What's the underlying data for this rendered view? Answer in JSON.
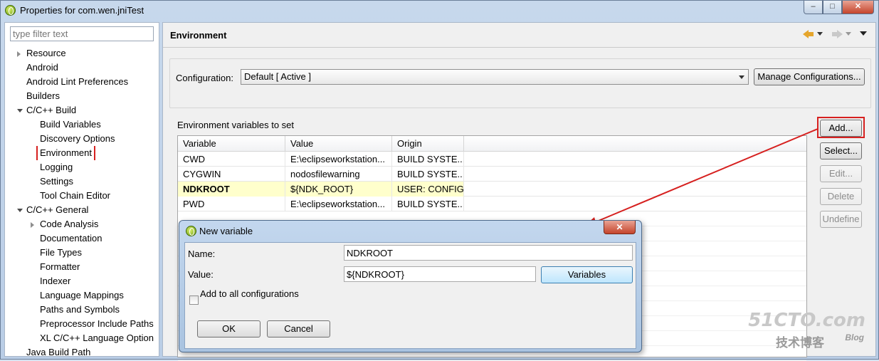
{
  "window": {
    "title": "Properties for com.wen.jniTest",
    "caption": {
      "minimize": "–",
      "maximize": "□",
      "close": "✕"
    }
  },
  "left_panel": {
    "filter_placeholder": "type filter text",
    "tree": [
      {
        "label": "Resource",
        "level": 0,
        "twisty": "closed"
      },
      {
        "label": "Android",
        "level": 0,
        "twisty": "none"
      },
      {
        "label": "Android Lint Preferences",
        "level": 0,
        "twisty": "none"
      },
      {
        "label": "Builders",
        "level": 0,
        "twisty": "none"
      },
      {
        "label": "C/C++ Build",
        "level": 0,
        "twisty": "open"
      },
      {
        "label": "Build Variables",
        "level": 1,
        "twisty": "none"
      },
      {
        "label": "Discovery Options",
        "level": 1,
        "twisty": "none"
      },
      {
        "label": "Environment",
        "level": 1,
        "twisty": "none",
        "selected": true
      },
      {
        "label": "Logging",
        "level": 1,
        "twisty": "none"
      },
      {
        "label": "Settings",
        "level": 1,
        "twisty": "none"
      },
      {
        "label": "Tool Chain Editor",
        "level": 1,
        "twisty": "none"
      },
      {
        "label": "C/C++ General",
        "level": 0,
        "twisty": "open"
      },
      {
        "label": "Code Analysis",
        "level": 1,
        "twisty": "closed"
      },
      {
        "label": "Documentation",
        "level": 1,
        "twisty": "none"
      },
      {
        "label": "File Types",
        "level": 1,
        "twisty": "none"
      },
      {
        "label": "Formatter",
        "level": 1,
        "twisty": "none"
      },
      {
        "label": "Indexer",
        "level": 1,
        "twisty": "none"
      },
      {
        "label": "Language Mappings",
        "level": 1,
        "twisty": "none"
      },
      {
        "label": "Paths and Symbols",
        "level": 1,
        "twisty": "none"
      },
      {
        "label": "Preprocessor Include Paths",
        "level": 1,
        "twisty": "none"
      },
      {
        "label": "XL C/C++ Language Option",
        "level": 1,
        "twisty": "none"
      },
      {
        "label": "Java Build Path",
        "level": 0,
        "twisty": "none"
      }
    ]
  },
  "right_panel": {
    "title": "Environment",
    "configuration_label": "Configuration:",
    "configuration_value": "Default  [ Active ]",
    "manage_button": "Manage Configurations...",
    "env_label": "Environment variables to set",
    "columns": [
      "Variable",
      "Value",
      "Origin"
    ],
    "rows": [
      {
        "variable": "CWD",
        "value": "E:\\eclipseworkstation...",
        "origin": "BUILD SYSTE...",
        "user": false
      },
      {
        "variable": "CYGWIN",
        "value": "nodosfilewarning",
        "origin": "BUILD SYSTE...",
        "user": false
      },
      {
        "variable": "NDKROOT",
        "value": "${NDK_ROOT}",
        "origin": "USER: CONFIG",
        "user": true
      },
      {
        "variable": "PWD",
        "value": "E:\\eclipseworkstation...",
        "origin": "BUILD SYSTE...",
        "user": false
      }
    ],
    "buttons": {
      "add": "Add...",
      "select": "Select...",
      "edit": "Edit...",
      "delete": "Delete",
      "undefine": "Undefine"
    }
  },
  "dialog": {
    "title": "New variable",
    "name_label": "Name:",
    "name_value": "NDKROOT",
    "value_label": "Value:",
    "value_value": "${NDKROOT}",
    "variables_button": "Variables",
    "checkbox_label": "Add to all configurations",
    "checkbox_checked": false,
    "ok_button": "OK",
    "cancel_button": "Cancel",
    "close_glyph": "✕"
  },
  "watermark": {
    "main": "51CTO.com",
    "sub": "技术博客",
    "blog": "Blog"
  },
  "colors": {
    "highlight": "#d6201f",
    "user_row": "#ffffcc",
    "arrow": "#d6201f"
  }
}
